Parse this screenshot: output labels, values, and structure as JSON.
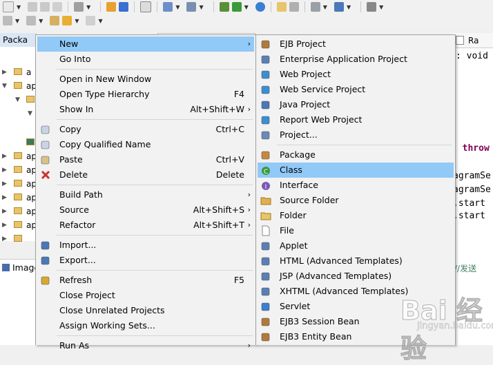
{
  "background": {
    "package_tab": "Packa",
    "tree_items": [
      "a",
      "ap",
      "ap",
      "ap",
      "ap",
      "ap",
      "ap",
      "ap"
    ],
    "image_tab": "Image",
    "editor_tab": "Ra",
    "editor_lines": [
      ": void",
      ") throw",
      "agramSe",
      "agramSe",
      ".start",
      ".start",
      "//发送"
    ]
  },
  "context_menu": [
    {
      "label": "New",
      "shortcut": "",
      "submenu": true,
      "highlighted": true,
      "icon": "none"
    },
    {
      "label": "Go Into",
      "shortcut": "",
      "submenu": false,
      "icon": "none"
    },
    {
      "separator": true
    },
    {
      "label": "Open in New Window",
      "shortcut": "",
      "submenu": false,
      "icon": "none"
    },
    {
      "label": "Open Type Hierarchy",
      "shortcut": "F4",
      "submenu": false,
      "icon": "none"
    },
    {
      "label": "Show In",
      "shortcut": "Alt+Shift+W",
      "submenu": true,
      "icon": "none"
    },
    {
      "separator": true
    },
    {
      "label": "Copy",
      "shortcut": "Ctrl+C",
      "submenu": false,
      "icon": "copy-icon"
    },
    {
      "label": "Copy Qualified Name",
      "shortcut": "",
      "submenu": false,
      "icon": "copy-icon"
    },
    {
      "label": "Paste",
      "shortcut": "Ctrl+V",
      "submenu": false,
      "icon": "paste-icon"
    },
    {
      "label": "Delete",
      "shortcut": "Delete",
      "submenu": false,
      "icon": "delete-icon"
    },
    {
      "separator": true
    },
    {
      "label": "Build Path",
      "shortcut": "",
      "submenu": true,
      "icon": "none"
    },
    {
      "label": "Source",
      "shortcut": "Alt+Shift+S",
      "submenu": true,
      "icon": "none"
    },
    {
      "label": "Refactor",
      "shortcut": "Alt+Shift+T",
      "submenu": true,
      "icon": "none"
    },
    {
      "separator": true
    },
    {
      "label": "Import...",
      "shortcut": "",
      "submenu": false,
      "icon": "import-icon"
    },
    {
      "label": "Export...",
      "shortcut": "",
      "submenu": false,
      "icon": "export-icon"
    },
    {
      "separator": true
    },
    {
      "label": "Refresh",
      "shortcut": "F5",
      "submenu": false,
      "icon": "refresh-icon"
    },
    {
      "label": "Close Project",
      "shortcut": "",
      "submenu": false,
      "icon": "none"
    },
    {
      "label": "Close Unrelated Projects",
      "shortcut": "",
      "submenu": false,
      "icon": "none"
    },
    {
      "label": "Assign Working Sets...",
      "shortcut": "",
      "submenu": false,
      "icon": "none"
    },
    {
      "separator": true
    },
    {
      "label": "Run As",
      "shortcut": "",
      "submenu": true,
      "icon": "none"
    }
  ],
  "new_submenu": [
    {
      "label": "EJB Project",
      "icon": "ejb-project-icon",
      "color": "#b07a3a"
    },
    {
      "label": "Enterprise Application Project",
      "icon": "enterprise-project-icon",
      "color": "#5a7fb5"
    },
    {
      "label": "Web Project",
      "icon": "web-project-icon",
      "color": "#3b8fd1"
    },
    {
      "label": "Web Service Project",
      "icon": "web-service-project-icon",
      "color": "#3b8fd1"
    },
    {
      "label": "Java Project",
      "icon": "java-project-icon",
      "color": "#4a78b8"
    },
    {
      "label": "Report Web Project",
      "icon": "report-project-icon",
      "color": "#3b8fd1"
    },
    {
      "label": "Project...",
      "icon": "project-icon",
      "color": "#6a8ab8"
    },
    {
      "separator": true
    },
    {
      "label": "Package",
      "icon": "package-icon",
      "color": "#c8883a"
    },
    {
      "label": "Class",
      "icon": "class-icon",
      "color": "#3a9a3a",
      "highlighted": true
    },
    {
      "label": "Interface",
      "icon": "interface-icon",
      "color": "#7a5ab5"
    },
    {
      "label": "Source Folder",
      "icon": "source-folder-icon",
      "color": "#e0b050"
    },
    {
      "label": "Folder",
      "icon": "folder-icon",
      "color": "#e8c56a"
    },
    {
      "label": "File",
      "icon": "file-icon",
      "color": "#ffffff"
    },
    {
      "label": "Applet",
      "icon": "applet-icon",
      "color": "#5a7fb5"
    },
    {
      "label": "HTML (Advanced Templates)",
      "icon": "html-icon",
      "color": "#5a7fb5"
    },
    {
      "label": "JSP (Advanced Templates)",
      "icon": "jsp-icon",
      "color": "#5a7fb5"
    },
    {
      "label": "XHTML (Advanced Templates)",
      "icon": "xhtml-icon",
      "color": "#5a7fb5"
    },
    {
      "label": "Servlet",
      "icon": "servlet-icon",
      "color": "#3b7fd1"
    },
    {
      "label": "EJB3 Session Bean",
      "icon": "session-bean-icon",
      "color": "#b07a3a"
    },
    {
      "label": "EJB3 Entity Bean",
      "icon": "entity-bean-icon",
      "color": "#b07a3a"
    }
  ],
  "watermark": {
    "logo": "Bai 经验",
    "sub": "jingyan.baidu.com"
  }
}
